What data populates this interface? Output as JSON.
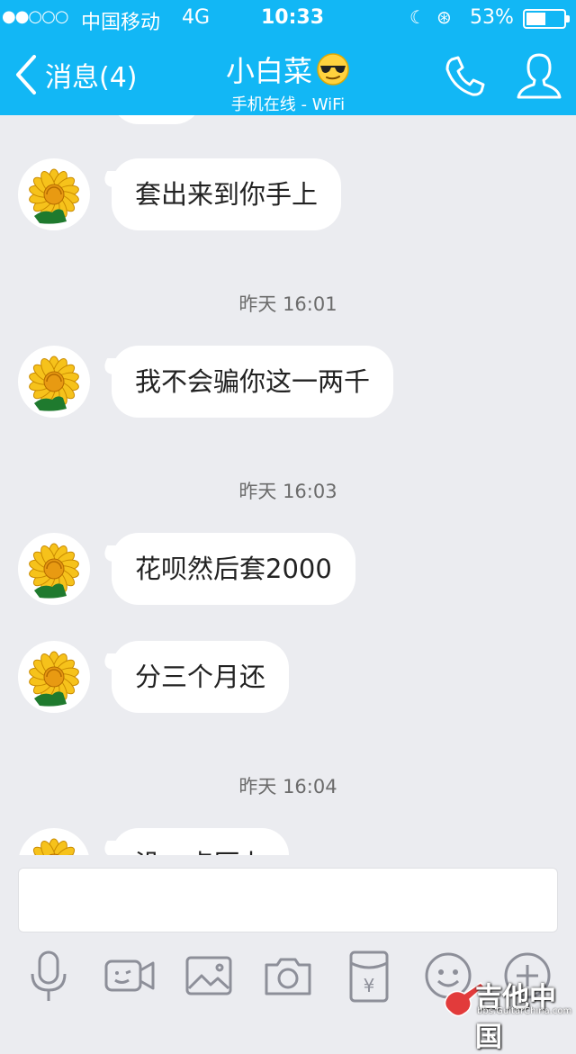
{
  "status_bar": {
    "signal": "●●○○○",
    "carrier": "中国移动",
    "network": "4G",
    "time": "10:33",
    "battery_pct": "53%",
    "battery_level": 0.53
  },
  "header": {
    "back_label": "消息(4)",
    "contact_name": "小白菜",
    "contact_status": "手机在线 - WiFi",
    "emoji": "sunglasses-emoji"
  },
  "messages": [
    {
      "type": "message",
      "text": "套出来到你手上"
    },
    {
      "type": "timestamp",
      "text": "昨天 16:01"
    },
    {
      "type": "message",
      "text": "我不会骗你这一两千"
    },
    {
      "type": "timestamp",
      "text": "昨天 16:03"
    },
    {
      "type": "message",
      "text": "花呗然后套2000"
    },
    {
      "type": "message",
      "text": "分三个月还"
    },
    {
      "type": "timestamp",
      "text": "昨天 16:04"
    },
    {
      "type": "message",
      "text": "没一点压力"
    }
  ],
  "toolbar": {
    "icons": [
      "microphone-icon",
      "video-icon",
      "image-icon",
      "camera-icon",
      "red-packet-icon",
      "emoji-icon",
      "plus-icon"
    ]
  },
  "watermark": {
    "title": "吉他中国",
    "url": "bbs.GuitarChina.com"
  },
  "colors": {
    "accent": "#12b7f5",
    "background": "#ebecf0",
    "bubble": "#ffffff"
  }
}
